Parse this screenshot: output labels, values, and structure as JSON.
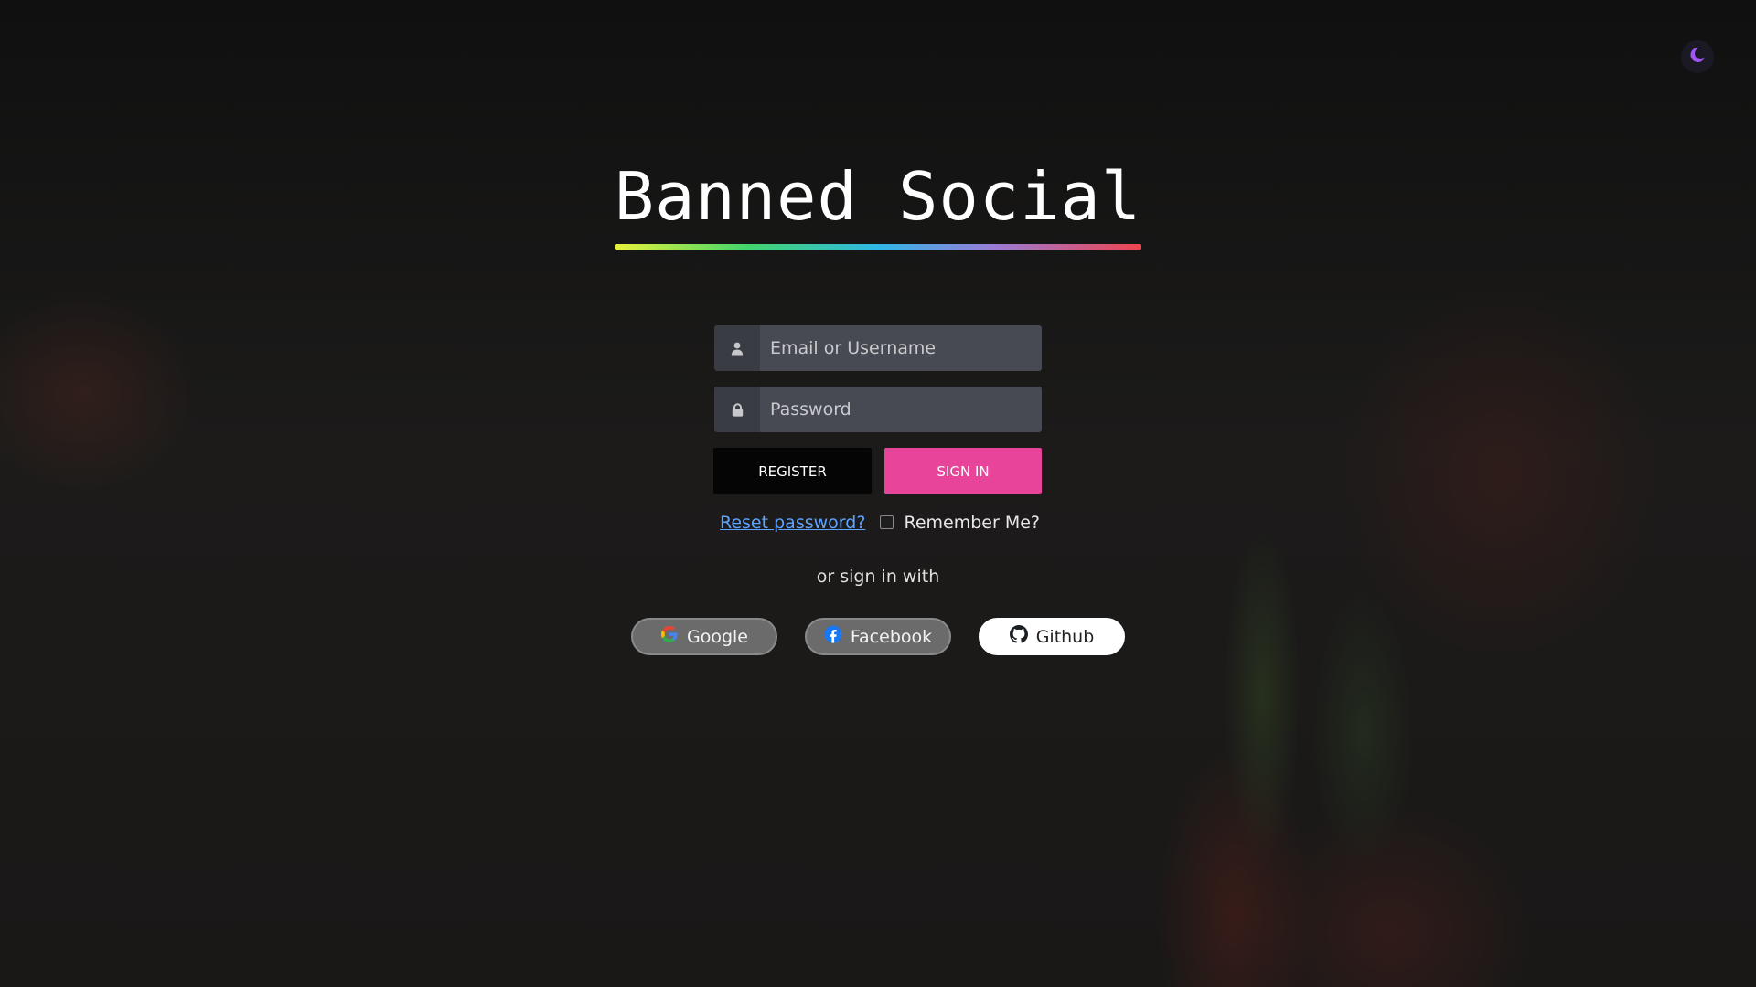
{
  "app": {
    "title": "Banned Social"
  },
  "theme_toggle": {
    "icon": "moon-icon",
    "color": "#a055f5"
  },
  "login_form": {
    "username_placeholder": "Email or Username",
    "password_placeholder": "Password",
    "username_icon": "user-icon",
    "password_icon": "lock-icon",
    "register_label": "REGISTER",
    "signin_label": "SIGN IN",
    "reset_link": "Reset password?",
    "remember_label": "Remember Me?",
    "remember_checked": false
  },
  "social": {
    "prompt": "or sign in with",
    "providers": [
      {
        "label": "Google",
        "icon": "google-icon"
      },
      {
        "label": "Facebook",
        "icon": "facebook-icon"
      },
      {
        "label": "Github",
        "icon": "github-icon"
      }
    ]
  },
  "colors": {
    "accent": "#e8459a",
    "link": "#5ea3ff",
    "background": "#161616"
  }
}
